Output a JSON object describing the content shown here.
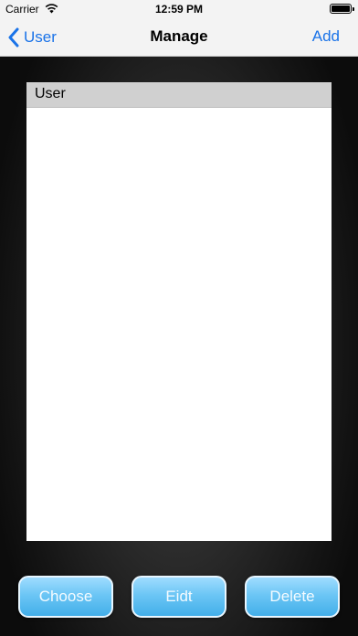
{
  "status_bar": {
    "carrier": "Carrier",
    "time": "12:59 PM",
    "battery_level": 1.0
  },
  "nav": {
    "back_label": "User",
    "title": "Manage",
    "add_label": "Add"
  },
  "list": {
    "header": "User",
    "items": []
  },
  "actions": {
    "choose_label": "Choose",
    "edit_label": "Eidt",
    "delete_label": "Delete"
  },
  "colors": {
    "accent": "#1a73e8",
    "button_top": "#9fdcff",
    "button_bottom": "#42aee9"
  }
}
